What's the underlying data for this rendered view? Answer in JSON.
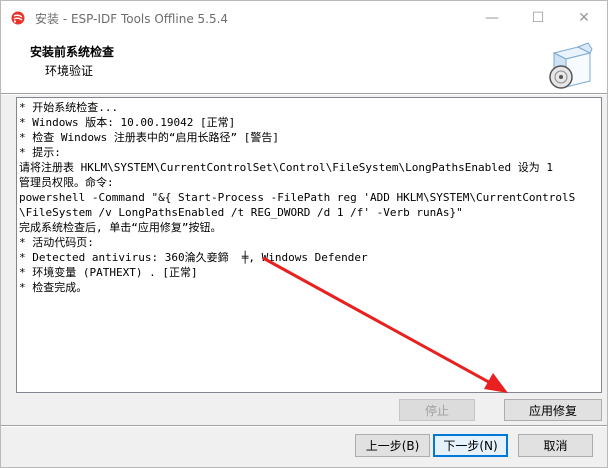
{
  "window": {
    "title": "安装 - ESP-IDF Tools Offline 5.5.4",
    "minimize_glyph": "—",
    "maximize_glyph": "☐",
    "close_glyph": "✕",
    "icon": "espressif-logo-icon"
  },
  "header": {
    "title": "安装前系统检查",
    "subtitle": "环境验证",
    "graphic_icon": "software-box-icon"
  },
  "log": {
    "lines": [
      "* 开始系统检查...",
      "* Windows 版本: 10.00.19042 [正常]",
      "* 检查 Windows 注册表中的“启用长路径” [警告]",
      "* 提示:",
      "请将注册表 HKLM\\SYSTEM\\CurrentControlSet\\Control\\FileSystem\\LongPathsEnabled 设为 1",
      "管理员权限。命令:",
      "powershell -Command \"&{ Start-Process -FilePath reg 'ADD HKLM\\SYSTEM\\CurrentControlS",
      "\\FileSystem /v LongPathsEnabled /t REG_DWORD /d 1 /f' -Verb runAs}\"",
      "完成系统检查后, 单击“应用修复”按钮。",
      "* 活动代码页:",
      "* Detected antivirus: 360淪久妾鍗  ╪, Windows Defender",
      "* 环境变量 (PATHEXT) . [正常]",
      "* 检查完成。"
    ]
  },
  "actions": {
    "stop_label": "停止",
    "apply_fix_label": "应用修复"
  },
  "nav": {
    "back_label": "上一步(B)",
    "next_label": "下一步(N)",
    "cancel_label": "取消"
  },
  "colors": {
    "annotation_arrow": "#e8201f",
    "default_button_border": "#0078d7"
  }
}
